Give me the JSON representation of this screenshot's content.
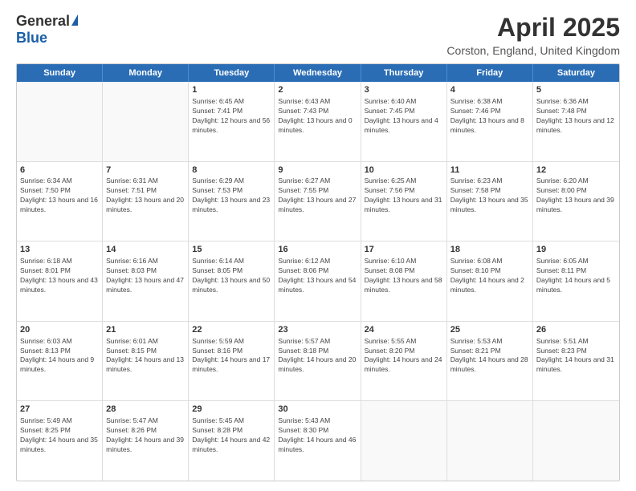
{
  "logo": {
    "general": "General",
    "blue": "Blue"
  },
  "title": {
    "month": "April 2025",
    "location": "Corston, England, United Kingdom"
  },
  "days": [
    "Sunday",
    "Monday",
    "Tuesday",
    "Wednesday",
    "Thursday",
    "Friday",
    "Saturday"
  ],
  "weeks": [
    [
      {
        "day": "",
        "info": ""
      },
      {
        "day": "",
        "info": ""
      },
      {
        "day": "1",
        "info": "Sunrise: 6:45 AM\nSunset: 7:41 PM\nDaylight: 12 hours and 56 minutes."
      },
      {
        "day": "2",
        "info": "Sunrise: 6:43 AM\nSunset: 7:43 PM\nDaylight: 13 hours and 0 minutes."
      },
      {
        "day": "3",
        "info": "Sunrise: 6:40 AM\nSunset: 7:45 PM\nDaylight: 13 hours and 4 minutes."
      },
      {
        "day": "4",
        "info": "Sunrise: 6:38 AM\nSunset: 7:46 PM\nDaylight: 13 hours and 8 minutes."
      },
      {
        "day": "5",
        "info": "Sunrise: 6:36 AM\nSunset: 7:48 PM\nDaylight: 13 hours and 12 minutes."
      }
    ],
    [
      {
        "day": "6",
        "info": "Sunrise: 6:34 AM\nSunset: 7:50 PM\nDaylight: 13 hours and 16 minutes."
      },
      {
        "day": "7",
        "info": "Sunrise: 6:31 AM\nSunset: 7:51 PM\nDaylight: 13 hours and 20 minutes."
      },
      {
        "day": "8",
        "info": "Sunrise: 6:29 AM\nSunset: 7:53 PM\nDaylight: 13 hours and 23 minutes."
      },
      {
        "day": "9",
        "info": "Sunrise: 6:27 AM\nSunset: 7:55 PM\nDaylight: 13 hours and 27 minutes."
      },
      {
        "day": "10",
        "info": "Sunrise: 6:25 AM\nSunset: 7:56 PM\nDaylight: 13 hours and 31 minutes."
      },
      {
        "day": "11",
        "info": "Sunrise: 6:23 AM\nSunset: 7:58 PM\nDaylight: 13 hours and 35 minutes."
      },
      {
        "day": "12",
        "info": "Sunrise: 6:20 AM\nSunset: 8:00 PM\nDaylight: 13 hours and 39 minutes."
      }
    ],
    [
      {
        "day": "13",
        "info": "Sunrise: 6:18 AM\nSunset: 8:01 PM\nDaylight: 13 hours and 43 minutes."
      },
      {
        "day": "14",
        "info": "Sunrise: 6:16 AM\nSunset: 8:03 PM\nDaylight: 13 hours and 47 minutes."
      },
      {
        "day": "15",
        "info": "Sunrise: 6:14 AM\nSunset: 8:05 PM\nDaylight: 13 hours and 50 minutes."
      },
      {
        "day": "16",
        "info": "Sunrise: 6:12 AM\nSunset: 8:06 PM\nDaylight: 13 hours and 54 minutes."
      },
      {
        "day": "17",
        "info": "Sunrise: 6:10 AM\nSunset: 8:08 PM\nDaylight: 13 hours and 58 minutes."
      },
      {
        "day": "18",
        "info": "Sunrise: 6:08 AM\nSunset: 8:10 PM\nDaylight: 14 hours and 2 minutes."
      },
      {
        "day": "19",
        "info": "Sunrise: 6:05 AM\nSunset: 8:11 PM\nDaylight: 14 hours and 5 minutes."
      }
    ],
    [
      {
        "day": "20",
        "info": "Sunrise: 6:03 AM\nSunset: 8:13 PM\nDaylight: 14 hours and 9 minutes."
      },
      {
        "day": "21",
        "info": "Sunrise: 6:01 AM\nSunset: 8:15 PM\nDaylight: 14 hours and 13 minutes."
      },
      {
        "day": "22",
        "info": "Sunrise: 5:59 AM\nSunset: 8:16 PM\nDaylight: 14 hours and 17 minutes."
      },
      {
        "day": "23",
        "info": "Sunrise: 5:57 AM\nSunset: 8:18 PM\nDaylight: 14 hours and 20 minutes."
      },
      {
        "day": "24",
        "info": "Sunrise: 5:55 AM\nSunset: 8:20 PM\nDaylight: 14 hours and 24 minutes."
      },
      {
        "day": "25",
        "info": "Sunrise: 5:53 AM\nSunset: 8:21 PM\nDaylight: 14 hours and 28 minutes."
      },
      {
        "day": "26",
        "info": "Sunrise: 5:51 AM\nSunset: 8:23 PM\nDaylight: 14 hours and 31 minutes."
      }
    ],
    [
      {
        "day": "27",
        "info": "Sunrise: 5:49 AM\nSunset: 8:25 PM\nDaylight: 14 hours and 35 minutes."
      },
      {
        "day": "28",
        "info": "Sunrise: 5:47 AM\nSunset: 8:26 PM\nDaylight: 14 hours and 39 minutes."
      },
      {
        "day": "29",
        "info": "Sunrise: 5:45 AM\nSunset: 8:28 PM\nDaylight: 14 hours and 42 minutes."
      },
      {
        "day": "30",
        "info": "Sunrise: 5:43 AM\nSunset: 8:30 PM\nDaylight: 14 hours and 46 minutes."
      },
      {
        "day": "",
        "info": ""
      },
      {
        "day": "",
        "info": ""
      },
      {
        "day": "",
        "info": ""
      }
    ]
  ]
}
